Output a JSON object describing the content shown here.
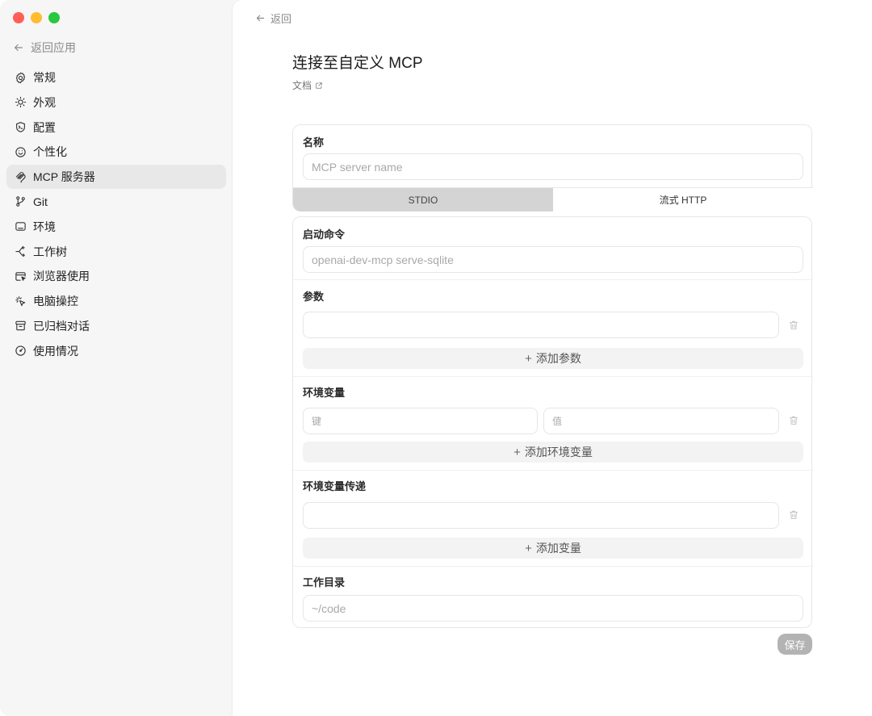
{
  "sidebar": {
    "back_label": "返回应用",
    "items": [
      {
        "label": "常规",
        "icon": "gear-icon"
      },
      {
        "label": "外观",
        "icon": "sun-icon"
      },
      {
        "label": "配置",
        "icon": "terminal-shield-icon"
      },
      {
        "label": "个性化",
        "icon": "smile-icon"
      },
      {
        "label": "MCP 服务器",
        "icon": "mcp-icon",
        "active": true
      },
      {
        "label": "Git",
        "icon": "git-branch-icon"
      },
      {
        "label": "环境",
        "icon": "monitor-icon"
      },
      {
        "label": "工作树",
        "icon": "worktree-icon"
      },
      {
        "label": "浏览器使用",
        "icon": "browser-cursor-icon"
      },
      {
        "label": "电脑操控",
        "icon": "click-sparkle-icon"
      },
      {
        "label": "已归档对话",
        "icon": "archive-icon"
      },
      {
        "label": "使用情况",
        "icon": "gauge-icon"
      }
    ]
  },
  "main": {
    "back_label": "返回",
    "title": "连接至自定义 MCP",
    "docs_label": "文档",
    "name_section": {
      "label": "名称",
      "placeholder": "MCP server name",
      "value": ""
    },
    "transport_tabs": [
      {
        "label": "STDIO",
        "active": true
      },
      {
        "label": "流式 HTTP",
        "active": false
      }
    ],
    "command": {
      "label": "启动命令",
      "placeholder": "openai-dev-mcp serve-sqlite"
    },
    "args": {
      "label": "参数",
      "placeholder": "",
      "add_label": "添加参数"
    },
    "env": {
      "label": "环境变量",
      "key_placeholder": "键",
      "value_placeholder": "值",
      "add_label": "添加环境变量"
    },
    "env_passthrough": {
      "label": "环境变量传递",
      "placeholder": "",
      "add_label": "添加变量"
    },
    "workdir": {
      "label": "工作目录",
      "placeholder": "~/code"
    },
    "save_label": "保存"
  },
  "colors": {
    "close": "#ff5f57",
    "minimize": "#febc2e",
    "zoom": "#28c840",
    "active_tab": "#d4d4d4",
    "save_disabled": "#b3b3b3"
  }
}
